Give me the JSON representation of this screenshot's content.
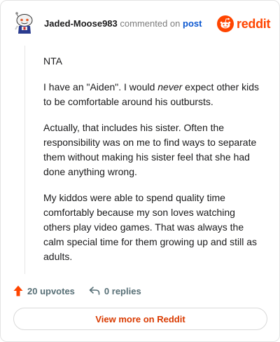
{
  "header": {
    "username": "Jaded-Moose983",
    "action_text": "commented on",
    "post_link_text": "post",
    "brand_text": "reddit",
    "avatar_icon": "snoo-avatar-icon",
    "brand_icon": "reddit-logo-icon"
  },
  "comment": {
    "p1": "NTA",
    "p2_before": "I have an \"Aiden\". I would ",
    "p2_em": "never",
    "p2_after": " expect other kids to be comfortable around his outbursts.",
    "p3": "Actually, that includes his sister. Often the responsibility was on me to find ways to separate them without making his sister feel that she had done anything wrong.",
    "p4": "My kiddos were able to spend quality time comfortably because my son loves watching others play video games. That was always the calm special time for them growing up and still as adults."
  },
  "footer": {
    "upvotes_label": "20 upvotes",
    "replies_label": "0 replies",
    "upvote_icon": "upvote-arrow-icon",
    "reply_icon": "reply-arrow-icon"
  },
  "cta": {
    "label": "View more on Reddit"
  },
  "colors": {
    "brand": "#ff4500",
    "cta_text": "#d93a00",
    "link": "#0b57d0",
    "muted": "#576f76"
  }
}
